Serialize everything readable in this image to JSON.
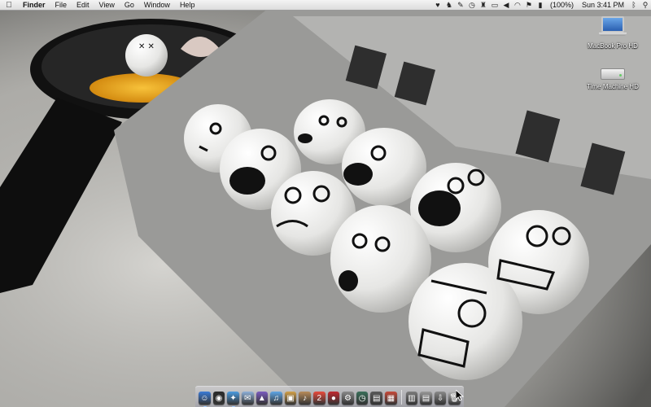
{
  "menubar": {
    "apple_icon": "apple-icon",
    "app_name": "Finder",
    "menus": [
      "File",
      "Edit",
      "View",
      "Go",
      "Window",
      "Help"
    ],
    "status_icons": [
      "heart-icon",
      "dog-icon",
      "script-icon",
      "time-machine-icon",
      "bluetooth-text-icon",
      "display-icon",
      "volume-icon",
      "wifi-icon",
      "battery-icon"
    ],
    "battery_percent": "(100%)",
    "clock": "Sun 3:41 PM",
    "right_icons": [
      "bluetooth-icon",
      "spotlight-icon"
    ]
  },
  "desktop_icons": [
    {
      "label": "MacBook Pro HD",
      "icon": "hard-drive-laptop-icon"
    },
    {
      "label": "Time Machine HD",
      "icon": "external-drive-icon"
    }
  ],
  "dock": {
    "apps": [
      {
        "name": "finder",
        "color": "#3b7bd6",
        "glyph": "☺",
        "running": true
      },
      {
        "name": "dashboard",
        "color": "#2a2a2a",
        "glyph": "◉",
        "running": false
      },
      {
        "name": "safari",
        "color": "#4b9be0",
        "glyph": "✦",
        "running": true
      },
      {
        "name": "mail",
        "color": "#8fb0d8",
        "glyph": "✉",
        "running": false
      },
      {
        "name": "preview",
        "color": "#7b5bbf",
        "glyph": "▲",
        "running": false
      },
      {
        "name": "itunes",
        "color": "#5fa6e6",
        "glyph": "♫",
        "running": false
      },
      {
        "name": "iphoto",
        "color": "#d2a04a",
        "glyph": "▣",
        "running": false
      },
      {
        "name": "garageband",
        "color": "#b98c5a",
        "glyph": "♪",
        "running": false
      },
      {
        "name": "ical",
        "color": "#e84a3c",
        "glyph": "2",
        "running": false
      },
      {
        "name": "photo-booth",
        "color": "#c0292f",
        "glyph": "●",
        "running": false
      },
      {
        "name": "system-preferences",
        "color": "#8a8a8a",
        "glyph": "⚙",
        "running": false
      },
      {
        "name": "time-machine",
        "color": "#3a6f5a",
        "glyph": "◷",
        "running": false
      },
      {
        "name": "front-row",
        "color": "#5a5a5a",
        "glyph": "▤",
        "running": false
      },
      {
        "name": "spaces",
        "color": "#c64a3a",
        "glyph": "▦",
        "running": false
      }
    ],
    "docs": [
      {
        "name": "applications-stack",
        "color": "#7d7d7d",
        "glyph": "▥"
      },
      {
        "name": "documents-stack",
        "color": "#9a9a9a",
        "glyph": "▤"
      },
      {
        "name": "downloads-stack",
        "color": "#8a8a8a",
        "glyph": "⇩"
      },
      {
        "name": "trash",
        "color": "#b5b5b5",
        "glyph": "🗑"
      }
    ]
  }
}
